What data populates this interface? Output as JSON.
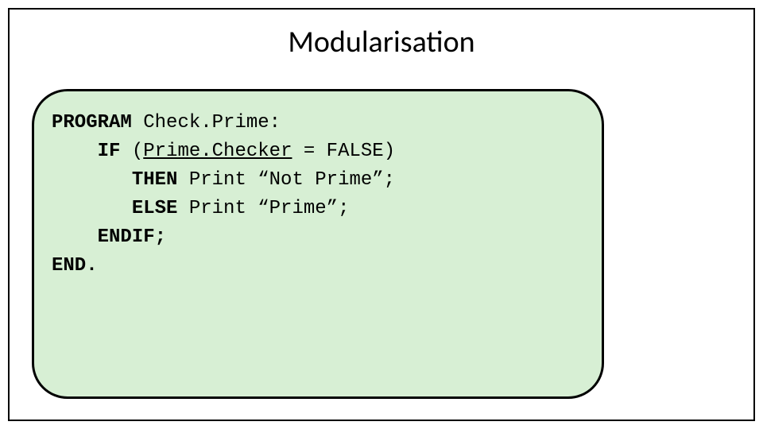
{
  "title": "Modularisation",
  "code": {
    "program_kw": "PROGRAM",
    "program_rest": " Check.Prime:",
    "if_kw": "IF",
    "if_open": " (",
    "if_underlined": "Prime.Checker",
    "if_rest": " = FALSE)",
    "then_kw": "THEN",
    "then_rest": " Print “Not Prime”;",
    "else_kw": "ELSE",
    "else_rest": " Print “Prime”;",
    "endif_kw": "ENDIF;",
    "end_kw": "END."
  }
}
